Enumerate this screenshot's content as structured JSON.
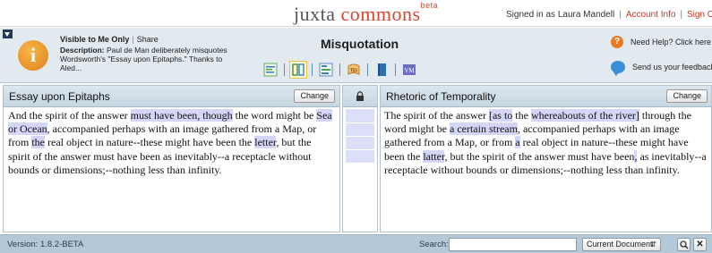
{
  "header": {
    "logo_part1": "juxta ",
    "logo_part2": "commons",
    "logo_beta": "beta",
    "signed_in": "Signed in as Laura Mandell",
    "account_info": "Account Info",
    "sign_out": "Sign Ou"
  },
  "info": {
    "visibility": "Visible to Me Only",
    "share": "Share",
    "description_label": "Description:",
    "description_text": "Paul de Man deliberately misquotes Wordsworth's \"Essay upon Epitaphs.\" Thanks to Aled...",
    "title": "Misquotation",
    "help": "Need Help? Click here",
    "feedback": "Send us your feedback",
    "toolbar_icons": [
      "heatmap-view-icon",
      "side-by-side-view-icon",
      "histogram-view-icon",
      "tei-export-icon",
      "edition-starter-icon",
      "versioning-machine-icon"
    ],
    "tei_label": "TEI",
    "vm_label": "VM"
  },
  "colors": {
    "highlight": "#d4d6f8",
    "logo_accent": "#d4472f",
    "footer_bg": "#b4c8d7"
  },
  "left_witness": {
    "title": "Essay upon Epitaphs",
    "change_label": "Change",
    "segments": [
      {
        "t": "And the spirit of the answer ",
        "h": false
      },
      {
        "t": "must have been, though",
        "h": true
      },
      {
        "t": " the word might be ",
        "h": false
      },
      {
        "t": "Sea or Ocean",
        "h": true
      },
      {
        "t": ", accompanied perhaps with an image gathered from a Map, or from ",
        "h": false
      },
      {
        "t": "the",
        "h": true
      },
      {
        "t": " real object in nature--these might have been the ",
        "h": false
      },
      {
        "t": "letter",
        "h": true
      },
      {
        "t": ", but the spirit of the answer must have been as inevitably--a receptacle without bounds or dimensions;--nothing less than infinity.",
        "h": false
      }
    ]
  },
  "right_witness": {
    "title": "Rhetoric of Temporality",
    "change_label": "Change",
    "segments": [
      {
        "t": "The spirit of the answer ",
        "h": false
      },
      {
        "t": "[as to",
        "h": true
      },
      {
        "t": " the ",
        "h": false
      },
      {
        "t": "whereabouts of the river]",
        "h": true
      },
      {
        "t": " through the word might be ",
        "h": false
      },
      {
        "t": "a certain stream",
        "h": true
      },
      {
        "t": ", accompanied perhaps with an image gathered from a Map, or from ",
        "h": false
      },
      {
        "t": "a",
        "h": true
      },
      {
        "t": " real object in nature--these might have been the ",
        "h": false
      },
      {
        "t": "latter",
        "h": true
      },
      {
        "t": ", but the spirit of the answer must have been",
        "h": false
      },
      {
        "t": ",",
        "h": true
      },
      {
        "t": " as inevitably--a receptacle without bounds or dimensions;--nothing less than infinity.",
        "h": false
      }
    ]
  },
  "gutter": {
    "lock_icon": "lock-icon"
  },
  "footer": {
    "version": "Version: 1.8.2-BETA",
    "search_label": "Search:",
    "search_value": "",
    "scope": "Current Document",
    "search_icon": "🔍",
    "close_icon": "✕"
  }
}
